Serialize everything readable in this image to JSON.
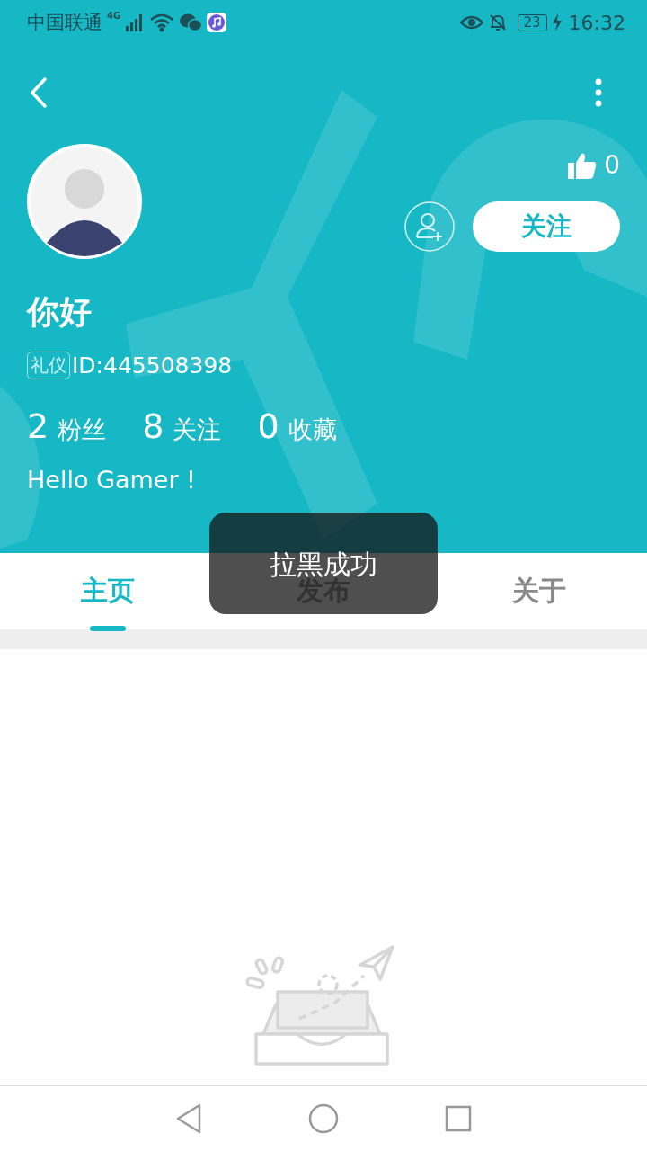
{
  "status_bar": {
    "carrier": "中国联通",
    "network": "4G",
    "battery": "23",
    "time": "16:32"
  },
  "profile": {
    "likes": "0",
    "follow_button": "关注",
    "name": "你好",
    "badge": "礼仪",
    "id": "ID:445508398",
    "stats": [
      {
        "count": "2",
        "name": "粉丝"
      },
      {
        "count": "8",
        "name": "关注"
      },
      {
        "count": "0",
        "name": "收藏"
      }
    ],
    "bio": "Hello Gamer !"
  },
  "tabs": [
    {
      "label": "主页",
      "selected": true
    },
    {
      "label": "发布",
      "selected": false
    },
    {
      "label": "关于",
      "selected": false
    }
  ],
  "toast": "拉黑成功"
}
